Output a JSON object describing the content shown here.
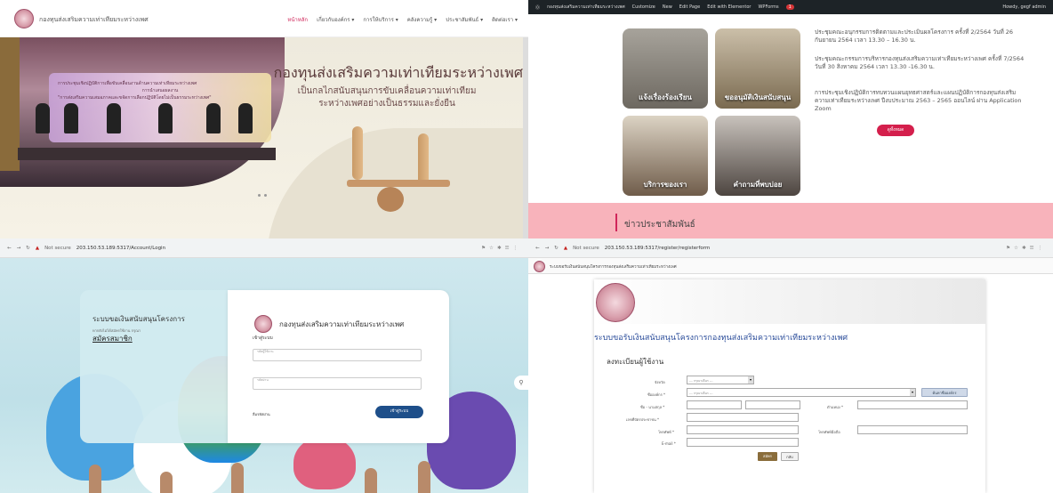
{
  "q1": {
    "brand": "กองทุนส่งเสริมความเท่าเทียมระหว่างเพศ",
    "nav": [
      "หน้าหลัก",
      "เกี่ยวกับองค์กร ▾",
      "การให้บริการ ▾",
      "คลังความรู้ ▾",
      "ประชาสัมพันธ์ ▾",
      "ติดต่อเรา ▾"
    ],
    "hero_title": "กองทุนส่งเสริมความเท่าเทียมระหว่างเพศ",
    "hero_sub_1": "เป็นกลไกสนับสนุนการขับเคลื่อนความเท่าเทียม",
    "hero_sub_2": "ระหว่างเพศอย่างเป็นธรรมและยั่งยืน",
    "banner_line_1": "การประชุมเชิงปฏิบัติการเพื่อขับเคลื่อนงานด้านความเท่าเทียมระหว่างเพศ",
    "banner_line_2": "การนำเสนอผลงาน",
    "banner_line_3": "\"การส่งเสริมความเสมอภาคและขจัดการเลือกปฏิบัติโดยไม่เป็นธรรมระหว่างเพศ\""
  },
  "q2": {
    "wp_items": [
      "กองทุนส่งเสริมความเท่าเทียมระหว่างเพศ",
      "Customize",
      "New",
      "Edit Page",
      "Edit with Elementor",
      "WPForms"
    ],
    "wp_badge": "1",
    "wp_user": "Howdy, gegf admin",
    "tiles": [
      "แจ้งเรื่องร้องเรียน",
      "ขออนุมัติเงินสนับสนุน",
      "บริการของเรา",
      "คำถามที่พบบ่อย"
    ],
    "news_1": "ประชุมคณะอนุกรรมการติดตามและประเมินผลโครงการ ครั้งที่ 2/2564 วันที่ 26 กันยายน 2564 เวลา 13.30 – 16.30 น.",
    "news_2": "ประชุมคณะกรรมการบริหารกองทุนส่งเสริมความเท่าเทียมระหว่างเพศ ครั้งที่ 7/2564 วันที่ 30 สิงหาคม 2564 เวลา 13.30 -16.30 น.",
    "news_3": "การประชุมเชิงปฏิบัติการทบทวนแผนยุทธศาสตร์และแผนปฏิบัติการกองทุนส่งเสริมความเท่าเทียมระหว่างเพศ ปีงบประมาณ 2563 – 2565 ออนไลน์ ผ่าน Application Zoom",
    "more_button": "ดูทั้งหมด",
    "pr_heading": "ข่าวประชาสัมพันธ์"
  },
  "q3": {
    "url": "203.150.53.189:5317/Account/Login",
    "not_secure": "Not secure",
    "left_title": "ระบบขอเงินสนับสนุนโครงการ",
    "left_hint": "หากยังไม่ได้สมัครใช้งาน กรุณา",
    "register_link": "สมัครสมาชิก",
    "org_name": "กองทุนส่งเสริมความเท่าเทียมระหว่างเพศ",
    "login_label": "เข้าสู่ระบบ",
    "username_ph": "รหัสผู้ใช้งาน",
    "password_ph": "รหัสผ่าน",
    "forgot": "ลืมรหัสผ่าน",
    "login_button": "เข้าสู่ระบบ"
  },
  "q4": {
    "url": "203.150.53.189:5317/register/registerform",
    "not_secure": "Not secure",
    "tab_title": "ระบบขอรับเงินสนับสนุนโครงการกองทุนส่งเสริมความเท่าเทียมระหว่างเพศ",
    "title": "ระบบขอรับเงินสนับสนุนโครงการกองทุนส่งเสริมความเท่าเทียมระหว่างเพศ",
    "subtitle": "ลงทะเบียนผู้ใช้งาน",
    "province_label": "จังหวัด",
    "org_label": "ชื่อองค์กร *",
    "select_ph": "--- กรุณาเลือก ---",
    "find_org_button": "ค้นหาชื่อองค์กร",
    "name_label": "ชื่อ - นามสกุล *",
    "position_label": "ตำแหน่ง *",
    "id_label": "เลขที่บัตรประชาชน *",
    "phone_label": "โทรศัพท์ *",
    "mobile_label": "โทรศัพท์มือถือ",
    "email_label": "E-mail *",
    "submit_button": "สมัคร",
    "back_button": "กลับ"
  }
}
